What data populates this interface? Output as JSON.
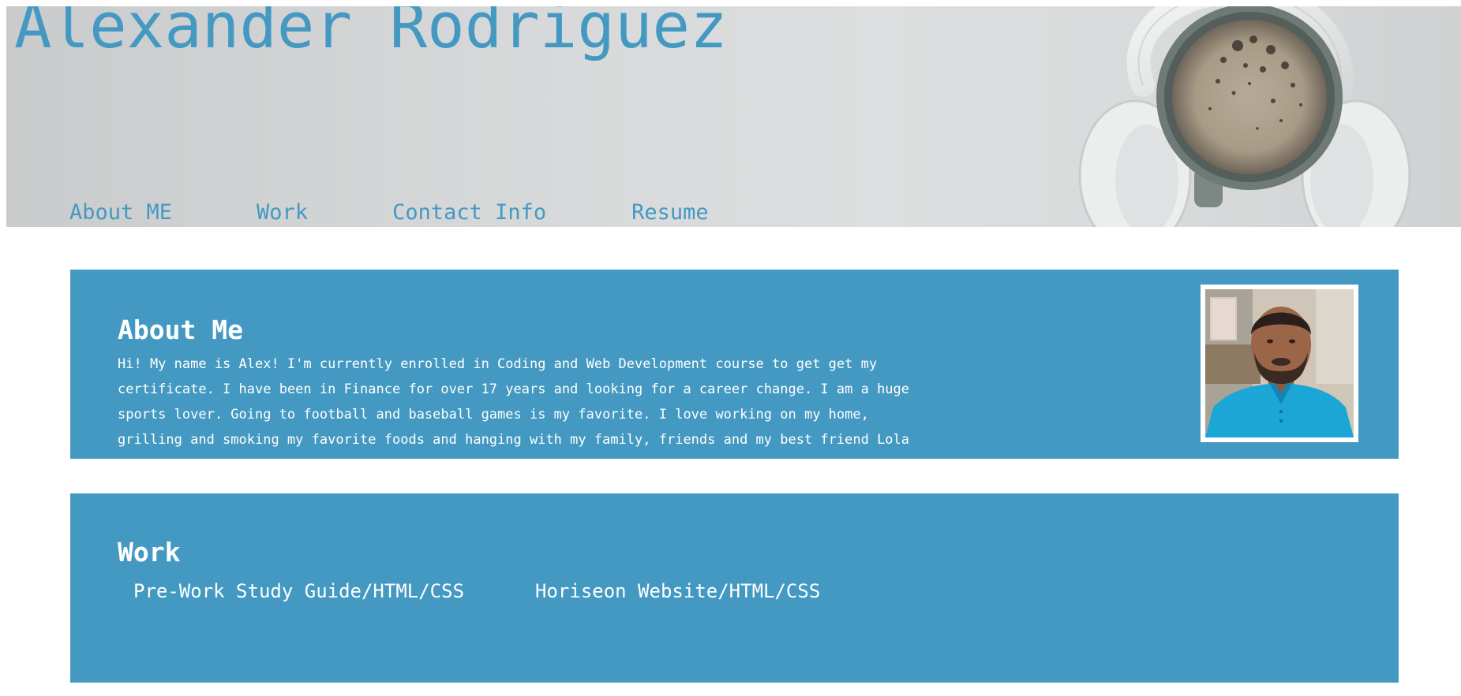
{
  "header": {
    "title": "Alexander Rodriguez",
    "nav": [
      {
        "label": "About ME"
      },
      {
        "label": "Work"
      },
      {
        "label": "Contact Info"
      },
      {
        "label": "Resume"
      }
    ]
  },
  "about": {
    "heading": "About Me",
    "text": "Hi! My name is Alex! I'm currently enrolled in Coding and Web Development course to get get my certificate. I have been in Finance for over 17 years and looking for a career change. I am a huge sports lover. Going to football and baseball games is my favorite. I love working on my home, grilling and smoking my favorite foods and hanging with my family, friends and my best friend Lola Bear."
  },
  "work": {
    "heading": "Work",
    "projects": [
      {
        "label": "Pre-Work Study Guide/HTML/CSS"
      },
      {
        "label": "Horiseon Website/HTML/CSS"
      }
    ]
  },
  "colors": {
    "accent": "#4499c2",
    "panel_text": "#ffffff",
    "page_background": "#ffffff"
  },
  "icons": {
    "hero_image": "coffee-headphones-image",
    "profile_photo": "profile-photo"
  }
}
